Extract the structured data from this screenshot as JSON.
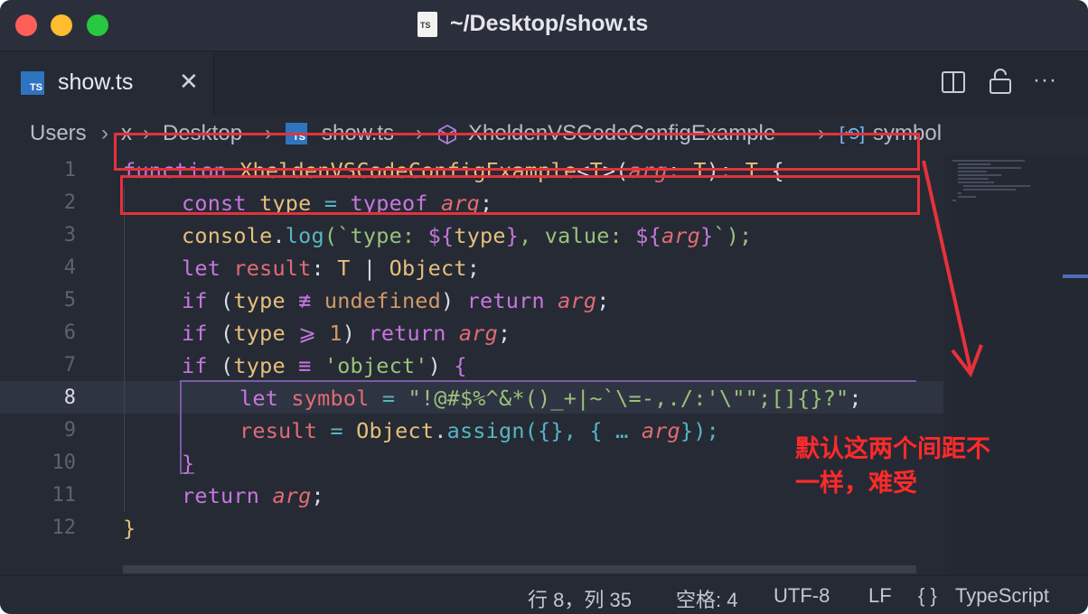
{
  "window": {
    "title": "~/Desktop/show.ts",
    "file_icon_text": "TS",
    "colors": {
      "close": "#ff5f57",
      "minimize": "#febc2e",
      "maximize": "#28c840",
      "editor_bg": "#262a35"
    }
  },
  "tab": {
    "icon_text": "TS",
    "label": "show.ts",
    "close_glyph": "✕"
  },
  "toolbar": {
    "split_icon": "split-editor-icon",
    "lock_icon": "lock-icon",
    "more_glyph": "···"
  },
  "breadcrumb": {
    "items": [
      "Users",
      "x",
      "Desktop",
      "show.ts",
      "XheldenVSCodeConfigExample",
      "symbol"
    ],
    "separator": "›",
    "ts_icon_text": "TS",
    "symbol_icon_text": "[⟲]"
  },
  "editor": {
    "line_numbers": [
      "1",
      "2",
      "3",
      "4",
      "5",
      "6",
      "7",
      "8",
      "9",
      "10",
      "11",
      "12"
    ],
    "active_line": "8"
  },
  "code": {
    "l1": {
      "t0": "function ",
      "t1": "XheldenVSCodeConfigExample",
      "t2": "<",
      "t3": "T",
      "t4": ">(",
      "t5": "arg",
      "t6": ": ",
      "t7": "T",
      "t8": "): ",
      "t9": "T",
      "t10": " {"
    },
    "l2": {
      "t0": "const ",
      "t1": "type",
      "t2": " = ",
      "t3": "typeof ",
      "t4": "arg",
      "t5": ";"
    },
    "l3": {
      "t0": "console",
      "t1": ".",
      "t2": "log",
      "t3": "(`type: ",
      "t4": "${",
      "t5": "type",
      "t6": "}",
      "t7": ", value: ",
      "t8": "${",
      "t9": "arg",
      "t10": "}",
      "t11": "`);"
    },
    "l4": {
      "t0": "let ",
      "t1": "result",
      "t2": ": ",
      "t3": "T",
      "t4": " | ",
      "t5": "Object",
      "t6": ";"
    },
    "l5": {
      "t0": "if ",
      "t1": "(",
      "t2": "type",
      "t3": " ≢ ",
      "t4": "undefined",
      "t5": ") ",
      "t6": "return ",
      "t7": "arg",
      "t8": ";"
    },
    "l6": {
      "t0": "if ",
      "t1": "(",
      "t2": "type",
      "t3": " ⩾ ",
      "t4": "1",
      "t5": ") ",
      "t6": "return ",
      "t7": "arg",
      "t8": ";"
    },
    "l7": {
      "t0": "if ",
      "t1": "(",
      "t2": "type",
      "t3": " ≡ ",
      "t4": "'object'",
      "t5": ") ",
      "t6": "{"
    },
    "l8": {
      "t0": "let ",
      "t1": "symbol",
      "t2": " = ",
      "t3": "\"!@#$%^&*()_+|~`\\=-,./:'\\\"\";[]{}?\"",
      "t4": ";"
    },
    "l9": {
      "t0": "result",
      "t1": " = ",
      "t2": "Object",
      "t3": ".",
      "t4": "assign",
      "t5": "({}, { … ",
      "t6": "arg",
      "t7": "});"
    },
    "l10": {
      "t0": "}"
    },
    "l11": {
      "t0": "return ",
      "t1": "arg",
      "t2": ";"
    },
    "l12": {
      "t0": "}"
    }
  },
  "statusbar": {
    "position": "行 8，列 35",
    "indent": "空格: 4",
    "encoding": "UTF-8",
    "eol": "LF",
    "language_icon": "{ }",
    "language": "TypeScript"
  },
  "annotation": {
    "line1": "默认这两个间距不",
    "line2": "一样，难受",
    "color": "#ff2a2a"
  }
}
